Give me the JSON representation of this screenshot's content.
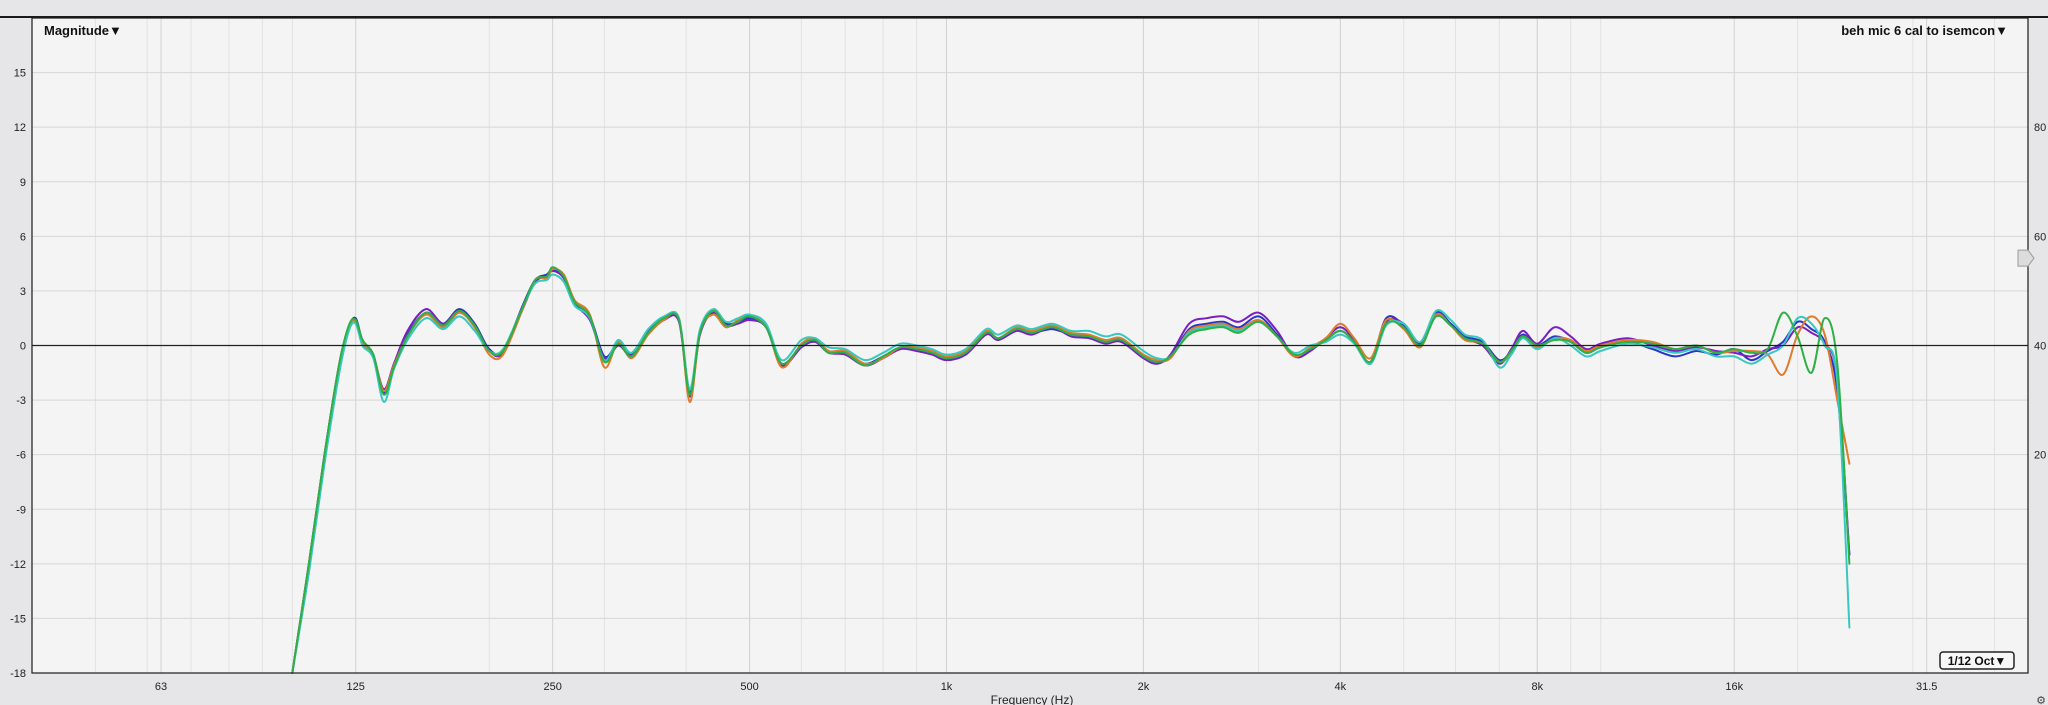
{
  "header": {
    "left_dropdown": "Magnitude▼",
    "right_dropdown": "beh mic 6 cal to isemcon▼",
    "smoothing_button": "1/12 Oct▼"
  },
  "colors": {
    "plot_background": "#f4f4f4",
    "page_background": "#e6e6e8",
    "grid": "#d9d9d9",
    "zero_line": "#202020"
  },
  "chart_data": {
    "type": "line",
    "title": "",
    "xlabel": "Frequency (Hz)",
    "ylabel": "",
    "x_scale": "log",
    "xlim": [
      40,
      45000
    ],
    "ylim": [
      -18,
      18
    ],
    "x_ticks": [
      {
        "value": 63,
        "label": "63"
      },
      {
        "value": 125,
        "label": "125"
      },
      {
        "value": 250,
        "label": "250"
      },
      {
        "value": 500,
        "label": "500"
      },
      {
        "value": 1000,
        "label": "1k"
      },
      {
        "value": 2000,
        "label": "2k"
      },
      {
        "value": 4000,
        "label": "4k"
      },
      {
        "value": 8000,
        "label": "8k"
      },
      {
        "value": 16000,
        "label": "16k"
      },
      {
        "value": 31500,
        "label": "31.5"
      }
    ],
    "y_ticks": [
      15,
      12,
      9,
      6,
      3,
      0,
      -3,
      -6,
      -9,
      -12,
      -15,
      -18
    ],
    "y_tick_labels": [
      "15",
      "12",
      "9",
      "6",
      "3",
      "0",
      "-3",
      "-6",
      "-9",
      "-12",
      "-15",
      "-18"
    ],
    "right_axis_ticks": [
      {
        "value": 80,
        "label": "80"
      },
      {
        "value": 60,
        "label": "60"
      },
      {
        "value": 40,
        "label": "40"
      },
      {
        "value": 20,
        "label": "20"
      }
    ],
    "right_ylim": [
      -20,
      100
    ],
    "right_marker_value": 56,
    "grid": true,
    "legend": "none",
    "x": [
      100,
      106,
      112,
      118,
      122,
      125,
      128,
      133,
      138,
      143,
      150,
      160,
      170,
      180,
      190,
      200,
      210,
      225,
      235,
      245,
      250,
      260,
      270,
      285,
      300,
      315,
      330,
      350,
      370,
      390,
      405,
      420,
      440,
      460,
      480,
      500,
      530,
      560,
      600,
      630,
      660,
      700,
      750,
      800,
      850,
      900,
      950,
      1000,
      1070,
      1150,
      1200,
      1280,
      1350,
      1450,
      1550,
      1650,
      1750,
      1850,
      2000,
      2100,
      2200,
      2350,
      2500,
      2650,
      2800,
      3000,
      3200,
      3400,
      3600,
      3800,
      4000,
      4200,
      4450,
      4700,
      5000,
      5300,
      5600,
      5900,
      6200,
      6600,
      7000,
      7300,
      7600,
      8000,
      8500,
      9000,
      9500,
      10000,
      11000,
      12000,
      13000,
      14000,
      15000,
      16000,
      17000,
      18000,
      19000,
      20000,
      21000,
      22000,
      23000,
      24000
    ],
    "series": [
      {
        "name": "",
        "color": "#2a35c8",
        "values": [
          -18,
          -12,
          -6,
          -1,
          1,
          1.5,
          0.3,
          -0.5,
          -2.6,
          -1.2,
          0.6,
          1.8,
          1.2,
          2.0,
          1.2,
          -0.2,
          -0.3,
          2.2,
          3.6,
          3.9,
          4.2,
          3.8,
          2.4,
          1.6,
          -0.6,
          0.1,
          -0.6,
          0.8,
          1.5,
          1.4,
          -2.6,
          0.8,
          1.9,
          1.2,
          1.3,
          1.5,
          1.1,
          -1.0,
          0.0,
          0.3,
          -0.3,
          -0.4,
          -1.0,
          -0.6,
          -0.1,
          -0.2,
          -0.4,
          -0.7,
          -0.4,
          0.7,
          0.4,
          0.9,
          0.7,
          0.9,
          0.6,
          0.5,
          0.2,
          0.3,
          -0.6,
          -0.9,
          -0.6,
          0.9,
          1.2,
          1.3,
          1.0,
          1.6,
          0.6,
          -0.5,
          -0.2,
          0.3,
          0.8,
          0.2,
          -0.9,
          1.5,
          1.1,
          0.0,
          1.8,
          1.2,
          0.5,
          0.2,
          -0.8,
          -0.3,
          0.6,
          0.0,
          0.5,
          0.2,
          -0.4,
          -0.1,
          0.2,
          -0.2,
          -0.6,
          -0.3,
          -0.5,
          -0.2,
          -0.8,
          -0.3,
          0.2,
          1.3,
          0.9,
          0.2,
          -2.5,
          -11.5
        ]
      },
      {
        "name": "",
        "color": "#7a1fc4",
        "values": [
          -18,
          -12,
          -6,
          -1,
          1,
          1.4,
          0.2,
          -0.6,
          -2.4,
          -1.0,
          0.8,
          2.0,
          1.2,
          1.9,
          1.0,
          -0.3,
          -0.4,
          2.0,
          3.5,
          3.8,
          4.1,
          3.7,
          2.3,
          1.4,
          -0.7,
          0.0,
          -0.5,
          0.7,
          1.4,
          1.3,
          -2.8,
          0.6,
          1.8,
          1.1,
          1.2,
          1.4,
          1.0,
          -1.1,
          -0.1,
          0.2,
          -0.4,
          -0.5,
          -1.1,
          -0.7,
          -0.2,
          -0.3,
          -0.5,
          -0.8,
          -0.5,
          0.6,
          0.3,
          0.8,
          0.6,
          1.0,
          0.5,
          0.4,
          0.1,
          0.2,
          -0.7,
          -1.0,
          -0.5,
          1.2,
          1.5,
          1.6,
          1.3,
          1.8,
          0.8,
          -0.6,
          -0.3,
          0.4,
          1.0,
          0.3,
          -1.0,
          1.3,
          1.2,
          0.1,
          1.6,
          1.1,
          0.4,
          0.0,
          -1.0,
          -0.2,
          0.8,
          0.1,
          1.0,
          0.5,
          -0.2,
          0.1,
          0.4,
          0.0,
          -0.3,
          -0.1,
          -0.3,
          -0.4,
          -0.6,
          -0.2,
          0.0,
          1.0,
          0.7,
          0.1,
          -1.8,
          -11.5
        ]
      },
      {
        "name": "",
        "color": "#e07b2e",
        "values": [
          -18,
          -12,
          -6,
          -1,
          1,
          1.3,
          0.2,
          -0.6,
          -2.5,
          -1.1,
          0.5,
          1.7,
          1.0,
          1.8,
          1.0,
          -0.5,
          -0.5,
          2.0,
          3.6,
          3.7,
          4.2,
          3.9,
          2.5,
          1.7,
          -1.2,
          0.2,
          -0.7,
          0.6,
          1.4,
          1.5,
          -3.1,
          0.7,
          1.7,
          1.0,
          1.4,
          1.6,
          1.1,
          -1.2,
          0.1,
          0.4,
          -0.3,
          -0.3,
          -1.0,
          -0.7,
          -0.1,
          -0.1,
          -0.3,
          -0.6,
          -0.3,
          0.8,
          0.4,
          1.0,
          0.8,
          1.1,
          0.7,
          0.6,
          0.3,
          0.4,
          -0.5,
          -0.8,
          -0.7,
          0.8,
          1.1,
          1.2,
          0.9,
          1.4,
          0.5,
          -0.6,
          -0.1,
          0.4,
          1.2,
          0.4,
          -0.7,
          1.4,
          0.9,
          -0.1,
          1.7,
          1.1,
          0.3,
          0.1,
          -0.9,
          -0.4,
          0.5,
          -0.1,
          0.4,
          0.3,
          -0.3,
          0.0,
          0.3,
          0.2,
          -0.2,
          0.0,
          -0.4,
          -0.3,
          -0.3,
          -0.5,
          -1.6,
          0.6,
          1.6,
          0.6,
          -3.0,
          -6.5
        ]
      },
      {
        "name": "",
        "color": "#38c8c0",
        "values": [
          -18,
          -12.5,
          -6.5,
          -1.5,
          0.8,
          1.2,
          0.0,
          -0.7,
          -3.1,
          -1.3,
          0.3,
          1.5,
          0.9,
          1.6,
          0.8,
          -0.3,
          -0.2,
          2.1,
          3.4,
          3.6,
          3.9,
          3.5,
          2.2,
          1.5,
          -0.8,
          0.3,
          -0.4,
          0.9,
          1.6,
          1.5,
          -2.4,
          0.9,
          2.0,
          1.3,
          1.5,
          1.7,
          1.2,
          -0.8,
          0.3,
          0.4,
          -0.1,
          -0.2,
          -0.8,
          -0.4,
          0.1,
          0.0,
          -0.2,
          -0.5,
          -0.2,
          0.9,
          0.6,
          1.1,
          0.9,
          1.2,
          0.8,
          0.8,
          0.5,
          0.6,
          -0.3,
          -0.7,
          -0.6,
          0.7,
          1.0,
          1.1,
          0.8,
          1.3,
          0.5,
          -0.4,
          0.0,
          0.2,
          0.6,
          0.1,
          -1.0,
          1.1,
          1.2,
          0.2,
          1.9,
          1.4,
          0.6,
          0.3,
          -1.2,
          -0.5,
          0.4,
          -0.2,
          0.4,
          0.0,
          -0.6,
          -0.3,
          0.1,
          -0.1,
          -0.4,
          -0.2,
          -0.6,
          -0.6,
          -1.0,
          -0.5,
          0.0,
          1.5,
          1.2,
          0.0,
          -2.0,
          -15.5
        ]
      },
      {
        "name": "",
        "color": "#2fb045",
        "values": [
          -18,
          -12,
          -6,
          -1,
          1.1,
          1.4,
          0.3,
          -0.5,
          -2.7,
          -1.2,
          0.5,
          1.8,
          1.1,
          1.9,
          1.1,
          -0.3,
          -0.3,
          2.1,
          3.6,
          3.8,
          4.3,
          3.8,
          2.4,
          1.6,
          -0.9,
          0.1,
          -0.6,
          0.7,
          1.5,
          1.4,
          -2.7,
          0.7,
          1.9,
          1.1,
          1.3,
          1.6,
          1.0,
          -1.0,
          0.0,
          0.3,
          -0.4,
          -0.4,
          -1.1,
          -0.6,
          -0.1,
          -0.2,
          -0.4,
          -0.7,
          -0.4,
          0.7,
          0.4,
          0.9,
          0.7,
          1.0,
          0.6,
          0.5,
          0.2,
          0.3,
          -0.6,
          -0.9,
          -0.6,
          0.6,
          0.9,
          1.0,
          0.7,
          1.3,
          0.5,
          -0.5,
          -0.2,
          0.3,
          0.8,
          0.2,
          -0.9,
          1.2,
          1.0,
          0.0,
          1.6,
          1.1,
          0.4,
          0.1,
          -0.9,
          -0.3,
          0.5,
          0.0,
          0.3,
          0.2,
          -0.4,
          -0.1,
          0.2,
          0.1,
          -0.2,
          0.0,
          -0.4,
          -0.2,
          -0.4,
          -0.2,
          1.8,
          0.5,
          -1.5,
          1.5,
          -1.0,
          -12.0
        ]
      }
    ]
  }
}
